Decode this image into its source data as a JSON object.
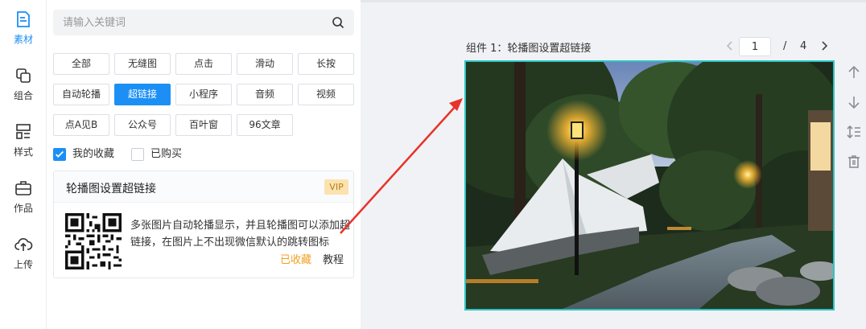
{
  "rail": {
    "items": [
      {
        "label": "素材",
        "icon": "file-text-icon",
        "active": true
      },
      {
        "label": "组合",
        "icon": "layers-icon",
        "active": false
      },
      {
        "label": "样式",
        "icon": "layout-icon",
        "active": false
      },
      {
        "label": "作品",
        "icon": "briefcase-icon",
        "active": false
      },
      {
        "label": "上传",
        "icon": "cloud-upload-icon",
        "active": false
      }
    ]
  },
  "search": {
    "placeholder": "请输入关键词",
    "value": ""
  },
  "tags": [
    {
      "label": "全部"
    },
    {
      "label": "无缝图"
    },
    {
      "label": "点击"
    },
    {
      "label": "滑动"
    },
    {
      "label": "长按"
    },
    {
      "label": "自动轮播"
    },
    {
      "label": "超链接",
      "active": true
    },
    {
      "label": "小程序"
    },
    {
      "label": "音频"
    },
    {
      "label": "视频"
    },
    {
      "label": "点A见B"
    },
    {
      "label": "公众号"
    },
    {
      "label": "百叶窗"
    },
    {
      "label": "96文章"
    }
  ],
  "filters": {
    "favorites": {
      "label": "我的收藏",
      "checked": true
    },
    "purchased": {
      "label": "已购买",
      "checked": false
    }
  },
  "card": {
    "title": "轮播图设置超链接",
    "badge": "VIP",
    "description": "多张图片自动轮播显示，并且轮播图可以添加超链接，在图片上不出现微信默认的跳转图标",
    "favorited_label": "已收藏",
    "tutorial_label": "教程"
  },
  "canvas": {
    "component_label": "组件 1：轮播图设置超链接",
    "page": {
      "current": "1",
      "separator": "/",
      "total": "4"
    }
  },
  "tools": [
    "arrow-up-icon",
    "arrow-down-icon",
    "line-height-icon",
    "trash-icon"
  ],
  "colors": {
    "accent": "#1c8ff5",
    "selection_border": "#2ec4c4",
    "favorite": "#f0a020",
    "vip_bg": "#fbe3b0",
    "annotation_arrow": "#e8322a"
  }
}
